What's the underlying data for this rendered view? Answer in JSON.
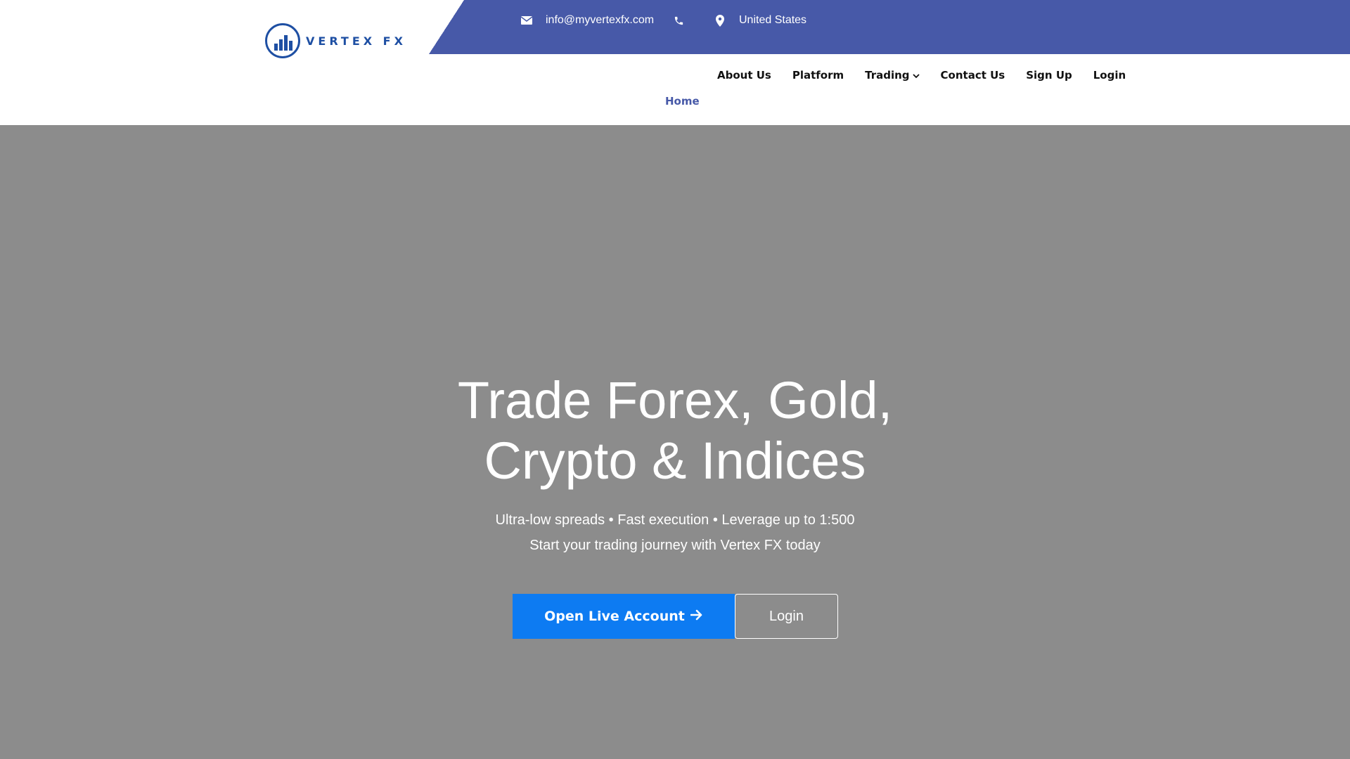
{
  "brand": {
    "name": "VERTEX FX",
    "color": "#1e4fa3"
  },
  "topbar": {
    "email": "info@myvertexfx.com",
    "phone": "",
    "location": "United States",
    "icons": {
      "email": "envelope-icon",
      "phone": "phone-icon",
      "location": "map-marker-icon"
    },
    "color": "#4759a8"
  },
  "nav": {
    "items": [
      {
        "label": "About Us"
      },
      {
        "label": "Platform"
      },
      {
        "label": "Trading"
      },
      {
        "label": "Contact Us"
      },
      {
        "label": "Sign Up"
      },
      {
        "label": "Login"
      }
    ],
    "home": "Home",
    "home_color": "#4759a8"
  },
  "hero": {
    "title_line1": "Trade Forex, Gold,",
    "title_line2": "Crypto & Indices",
    "subtitle1": "Ultra-low spreads • Fast execution • Leverage up to 1:500",
    "subtitle2": "Start your trading journey with Vertex FX today",
    "primary_button": "Open Live Account",
    "secondary_button": "Login",
    "background": "#8c8c8c",
    "primary_color": "#0d7bf2"
  }
}
